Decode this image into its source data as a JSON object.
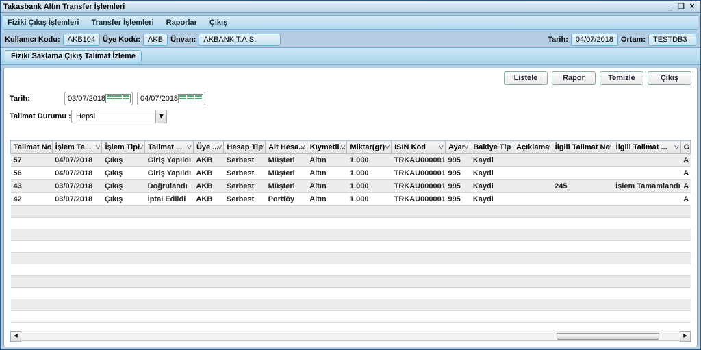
{
  "window": {
    "title": "Takasbank Altın Transfer İşlemleri"
  },
  "menu": {
    "item1": "Fiziki Çıkış İşlemleri",
    "item2": "Transfer İşlemleri",
    "item3": "Raporlar",
    "item4": "Çıkış"
  },
  "info": {
    "kullanici_label": "Kullanıcı Kodu:",
    "kullanici": "AKB104",
    "uye_label": "Üye Kodu:",
    "uye": "AKB",
    "unvan_label": "Ünvan:",
    "unvan": "AKBANK T.A.S.",
    "tarih_label": "Tarih:",
    "tarih": "04/07/2018",
    "ortam_label": "Ortam:",
    "ortam": "TESTDB3"
  },
  "subtab": "Fiziki Saklama Çıkış Talimat İzleme",
  "buttons": {
    "listele": "Listele",
    "rapor": "Rapor",
    "temizle": "Temizle",
    "cikis": "Çıkış"
  },
  "filters": {
    "tarih_label": "Tarih:",
    "date_from": "03/07/2018",
    "date_to": "04/07/2018",
    "durum_label": "Talimat Durumu :",
    "durum": "Hepsi"
  },
  "cols": {
    "c0": "Talimat No",
    "c1": "İşlem Ta...",
    "c2": "İşlem Tipi",
    "c3": "Talimat ...",
    "c4": "Üye ...",
    "c5": "Hesap Tip",
    "c6": "Alt Hesa...",
    "c7": "Kıymetli...",
    "c8": "Miktar(gr)",
    "c9": "ISIN Kod",
    "c10": "Ayar",
    "c11": "Bakiye Tip",
    "c12": "Açıklama",
    "c13": "İlgili Talimat No",
    "c14": "İlgili Talimat ...",
    "c15": "G"
  },
  "rows": [
    {
      "c0": "57",
      "c1": "04/07/2018",
      "c2": "Çıkış",
      "c3": "Giriş Yapıldı",
      "c4": "AKB",
      "c5": "Serbest",
      "c6": "Müşteri",
      "c7": "Altın",
      "c8": "1.000",
      "c9": "TRKAU000001",
      "c10": "995",
      "c11": "Kaydi",
      "c12": "",
      "c13": "",
      "c14": "",
      "c15": "A"
    },
    {
      "c0": "56",
      "c1": "04/07/2018",
      "c2": "Çıkış",
      "c3": "Giriş Yapıldı",
      "c4": "AKB",
      "c5": "Serbest",
      "c6": "Müşteri",
      "c7": "Altın",
      "c8": "1.000",
      "c9": "TRKAU000001",
      "c10": "995",
      "c11": "Kaydi",
      "c12": "",
      "c13": "",
      "c14": "",
      "c15": "A"
    },
    {
      "c0": "43",
      "c1": "03/07/2018",
      "c2": "Çıkış",
      "c3": "Doğrulandı",
      "c4": "AKB",
      "c5": "Serbest",
      "c6": "Müşteri",
      "c7": "Altın",
      "c8": "1.000",
      "c9": "TRKAU000001",
      "c10": "995",
      "c11": "Kaydi",
      "c12": "",
      "c13": "245",
      "c14": "İşlem Tamamlandı",
      "c15": "A"
    },
    {
      "c0": "42",
      "c1": "03/07/2018",
      "c2": "Çıkış",
      "c3": "İptal Edildi",
      "c4": "AKB",
      "c5": "Serbest",
      "c6": "Portföy",
      "c7": "Altın",
      "c8": "1.000",
      "c9": "TRKAU000001",
      "c10": "995",
      "c11": "Kaydi",
      "c12": "",
      "c13": "",
      "c14": "",
      "c15": "A"
    }
  ]
}
